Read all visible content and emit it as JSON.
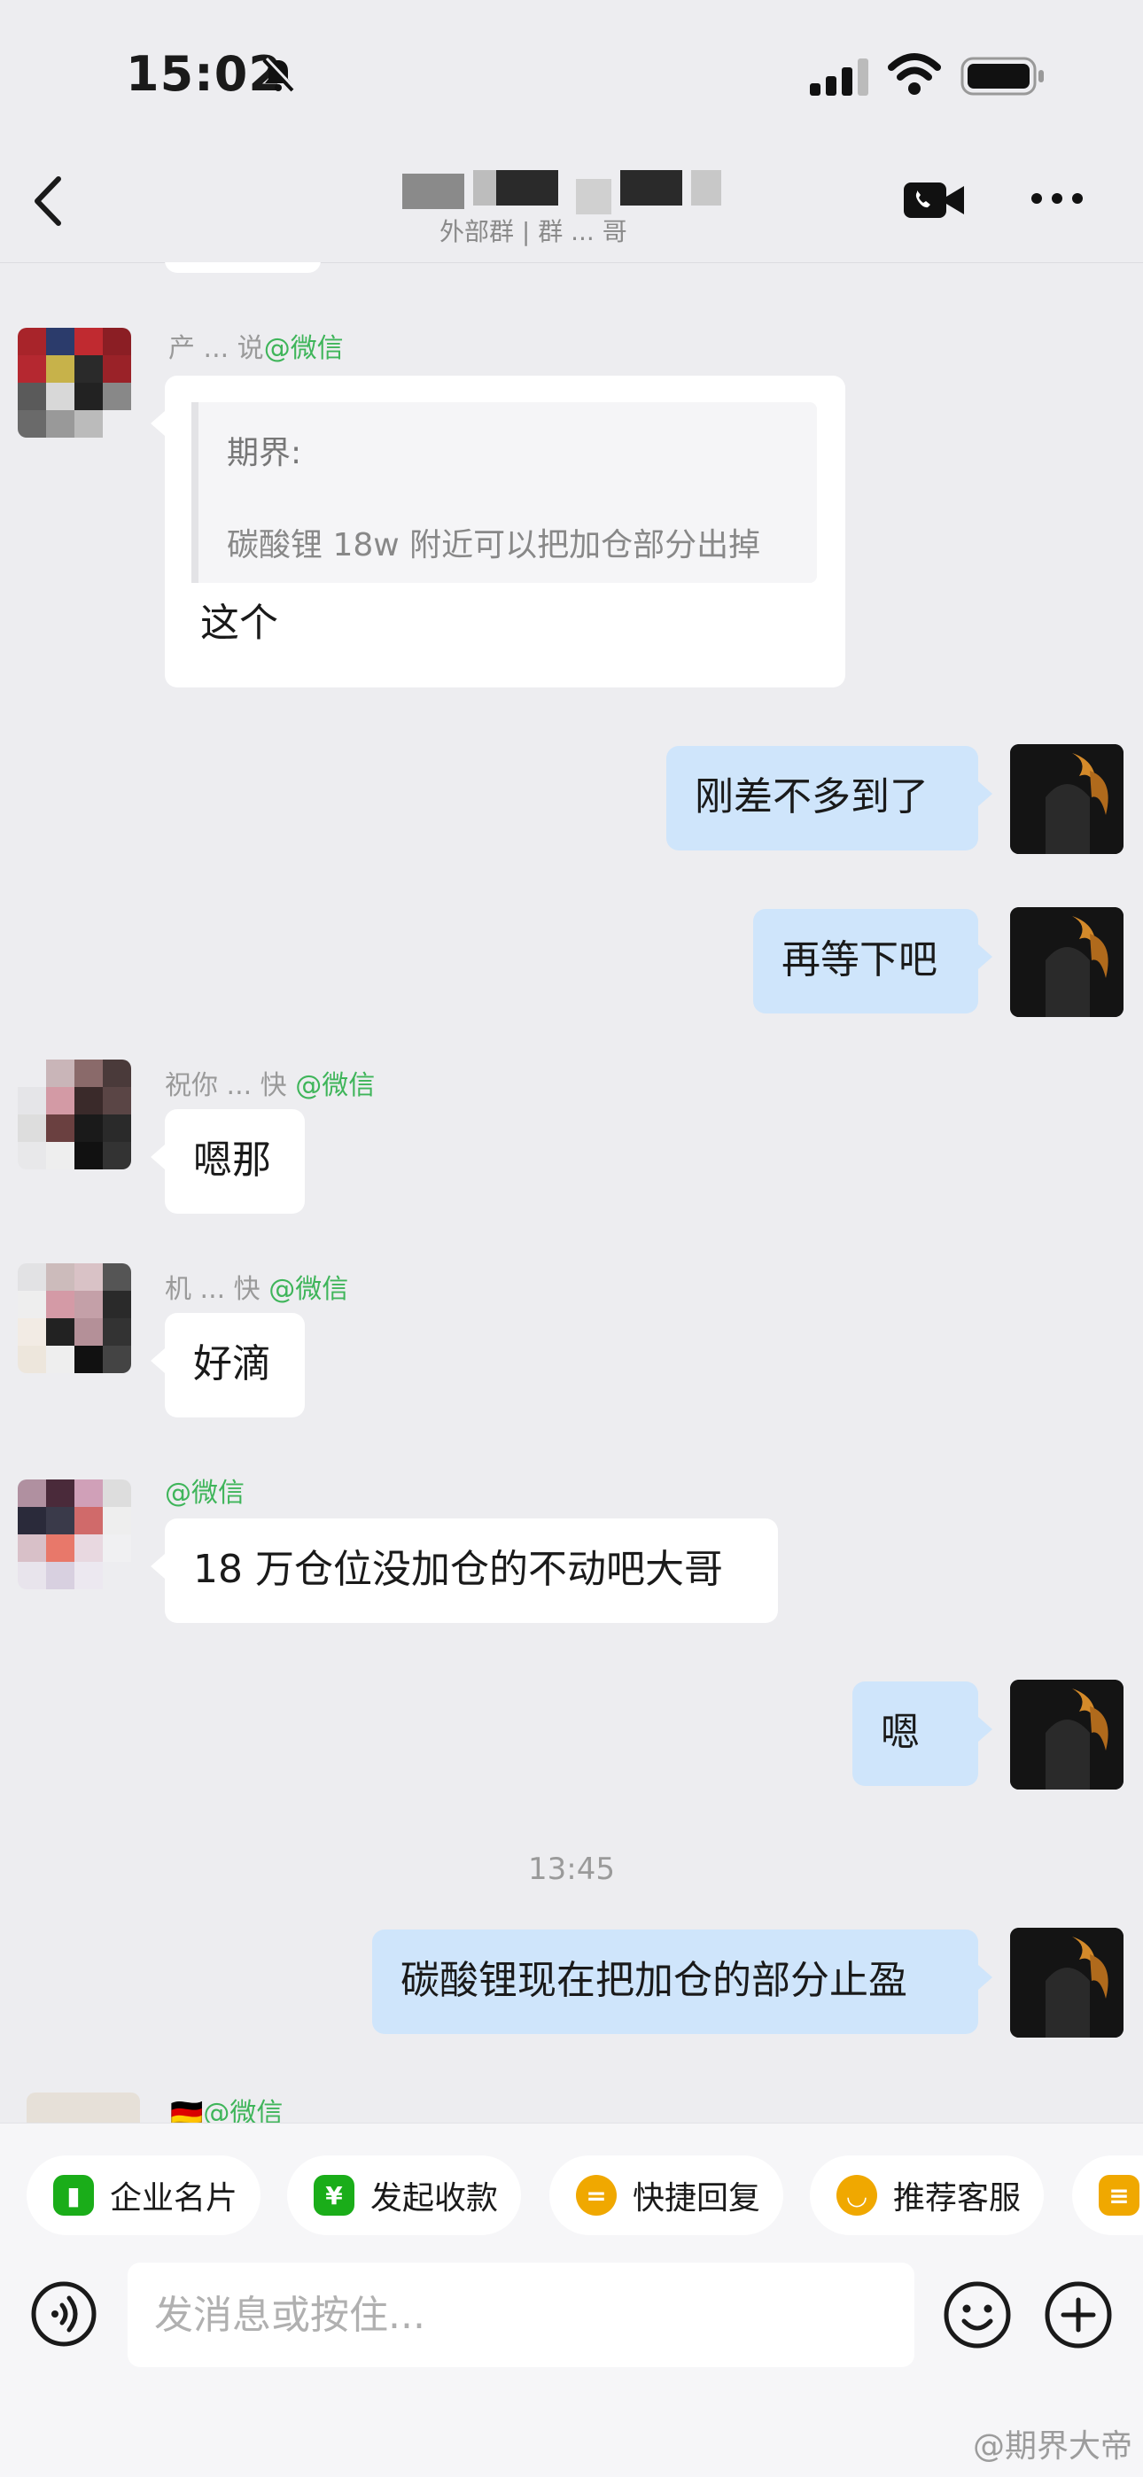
{
  "status_bar": {
    "time": "15:02"
  },
  "header": {
    "title": "",
    "subtitle": "外部群 | 群 ... 哥"
  },
  "messages": [
    {
      "sender": "产 ... 说",
      "source": "@微信",
      "quote_author": "期界:",
      "quote_text": "碳酸锂 18w 附近可以把加仓部分出掉",
      "text": "这个"
    },
    {
      "text": "刚差不多到了"
    },
    {
      "text": "再等下吧"
    },
    {
      "sender": "祝你 ... 快",
      "source": "@微信",
      "text": "嗯那"
    },
    {
      "sender": "机 ... 快",
      "source": "@微信",
      "text": "好滴"
    },
    {
      "sender": "",
      "source": "@微信",
      "text": "18 万仓位没加仓的不动吧大哥"
    },
    {
      "text": "嗯"
    },
    {
      "timestamp": "13:45"
    },
    {
      "text": "碳酸锂现在把加仓的部分止盈"
    },
    {
      "sender": "🇩🇪",
      "source": "@微信"
    }
  ],
  "quick_actions": [
    {
      "label": "企业名片",
      "color": "#1aad19",
      "icon": "card-icon"
    },
    {
      "label": "发起收款",
      "color": "#1aad19",
      "icon": "yuan-icon"
    },
    {
      "label": "快捷回复",
      "color": "#f0a800",
      "icon": "quick-reply-icon"
    },
    {
      "label": "推荐客服",
      "color": "#f0a800",
      "icon": "service-icon"
    }
  ],
  "input": {
    "placeholder": "发消息或按住..."
  },
  "watermark": "@期界大帝"
}
